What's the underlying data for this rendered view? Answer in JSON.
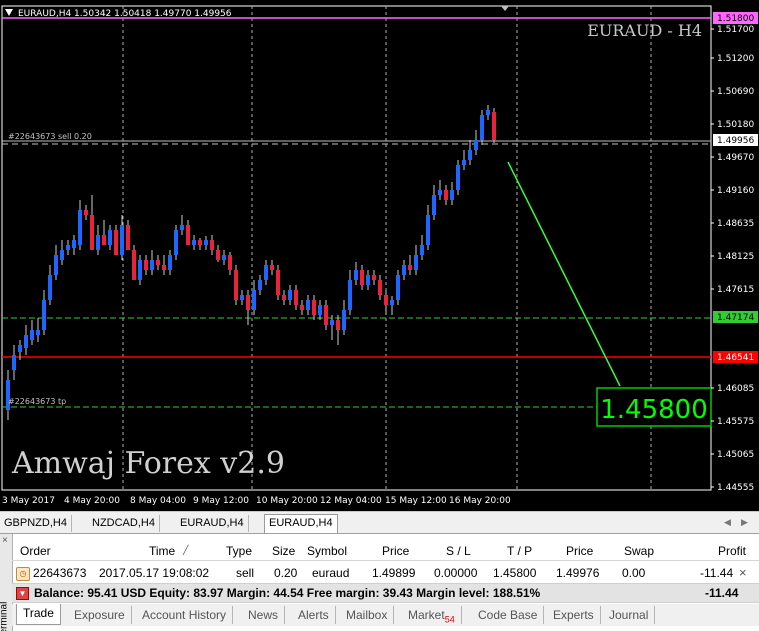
{
  "chart": {
    "info": "EURAUD,H4  1.50342 1.50418 1.49770 1.49956",
    "title": "EURAUD - H4",
    "watermark": "Amwaj Forex v2.9",
    "order_label_sell": "#22643673 sell 0.20",
    "order_label_tp": "#22643673 tp",
    "target_price": "1.45800",
    "price_axis": [
      "1.51700",
      "1.51200",
      "1.50690",
      "1.50180",
      "1.49670",
      "1.49160",
      "1.48635",
      "1.48125",
      "1.47615",
      "1.47105",
      "1.46085",
      "1.45575",
      "1.45065",
      "1.44555"
    ],
    "price_tags": {
      "magenta": "1.51800",
      "current": "1.49956",
      "green": "1.47174",
      "red": "1.46541"
    },
    "time_axis": [
      "3 May 2017",
      "4 May 20:00",
      "8 May 04:00",
      "9 May 12:00",
      "10 May 20:00",
      "12 May 04:00",
      "15 May 12:00",
      "16 May 20:00"
    ],
    "colors": {
      "bull": "#1e66ff",
      "bear": "#e8233b",
      "grid": "#b0b0b0",
      "red_line": "#ff0000",
      "green_line": "#33cc33",
      "magenta_line": "#ff66ff",
      "target": "#00ff00"
    }
  },
  "chart_tabs": [
    "GBPNZD,H4",
    "NZDCAD,H4",
    "EURAUD,H4",
    "EURAUD,H4"
  ],
  "terminal": {
    "side_label": "Terminal",
    "headers": [
      "Order",
      "Time",
      "Type",
      "Size",
      "Symbol",
      "Price",
      "S / L",
      "T / P",
      "Price",
      "Swap",
      "Profit"
    ],
    "row": {
      "order": "22643673",
      "time": "2017.05.17 19:08:02",
      "type": "sell",
      "size": "0.20",
      "symbol": "euraud",
      "price_open": "1.49899",
      "sl": "0.00000",
      "tp": "1.45800",
      "price_current": "1.49976",
      "swap": "0.00",
      "profit": "-11.44",
      "close": "×"
    },
    "balance_line": "Balance: 95.41 USD  Equity: 83.97  Margin: 44.54  Free margin: 39.43  Margin level: 188.51%",
    "balance_profit": "-11.44",
    "tabs": [
      "Trade",
      "Exposure",
      "Account History",
      "News",
      "Alerts",
      "Mailbox",
      "Market",
      "Code Base",
      "Experts",
      "Journal"
    ],
    "market_badge": "54"
  }
}
